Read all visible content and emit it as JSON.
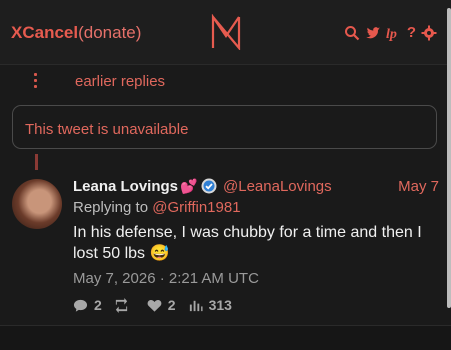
{
  "header": {
    "brand_bold": "XCancel",
    "brand_suffix": "(donate)",
    "logo_letter": "N",
    "tools": {
      "search_icon": "search-icon",
      "twitter_icon": "bird-icon",
      "lp_icon": "lp-icon",
      "help_label": "?",
      "settings_icon": "gear-icon"
    }
  },
  "earlier": {
    "label": "earlier replies"
  },
  "unavailable": {
    "text": "This tweet is unavailable"
  },
  "tweet": {
    "author_name": "Leana Lovings",
    "name_badge": "💕",
    "handle": "@LeanaLovings",
    "date": "May 7",
    "replying_prefix": "Replying to ",
    "replying_handle": "@Griffin1981",
    "text": "In his defense, I was chubby for a time and then I lost 50 lbs 😅",
    "timestamp": "May 7, 2026 · 2:21 AM UTC",
    "stats": {
      "replies": "2",
      "retweets": "",
      "likes": "2",
      "views": "313"
    }
  },
  "colors": {
    "accent": "#e0685d",
    "background": "#1a1a1a",
    "text": "#f0f0f0"
  }
}
